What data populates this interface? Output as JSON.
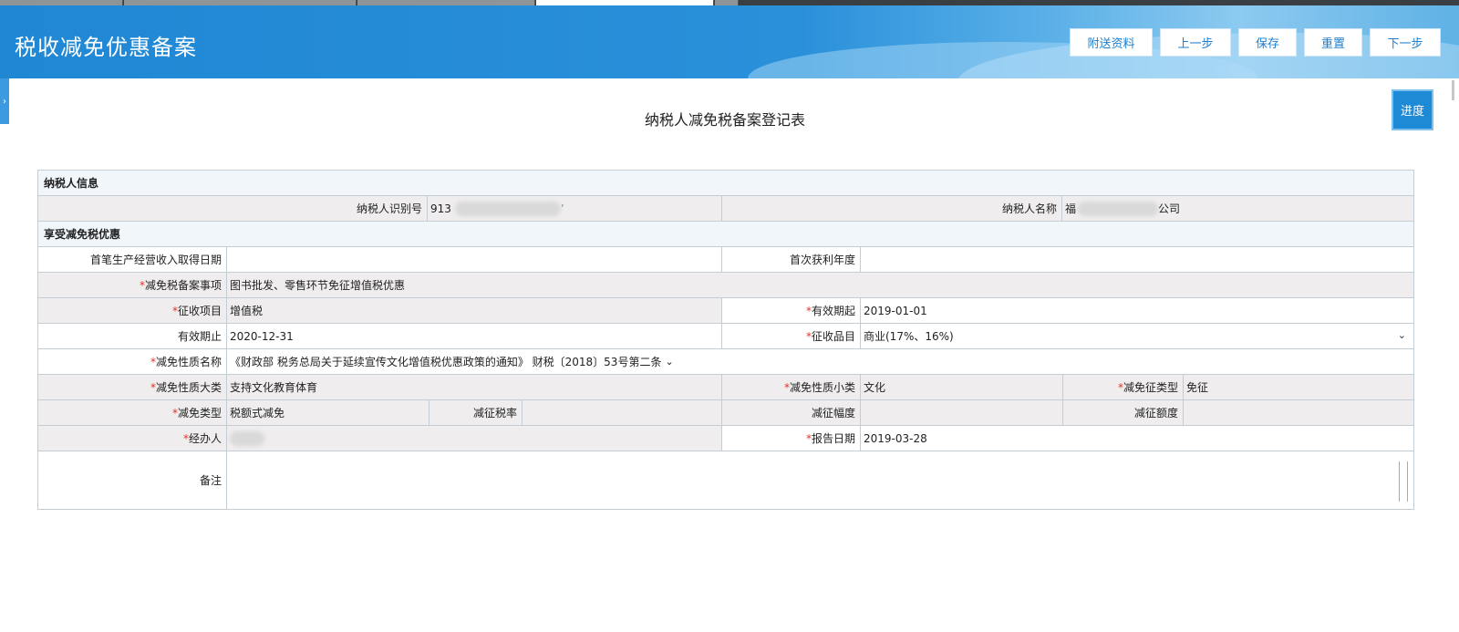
{
  "header": {
    "title": "税收减免优惠备案",
    "buttons": [
      "附送资料",
      "上一步",
      "保存",
      "重置",
      "下一步"
    ]
  },
  "progress_label": "进度",
  "form_title": "纳税人减免税备案登记表",
  "sections": {
    "taxpayer_info": "纳税人信息",
    "benefit": "享受减免税优惠"
  },
  "taxpayer": {
    "id_label": "纳税人识别号",
    "id_value_prefix": "913",
    "id_value_suffix": "’",
    "name_label": "纳税人名称",
    "name_value_prefix": "福",
    "name_value_suffix": "公司"
  },
  "fields": {
    "first_income_date_label": "首笔生产经营收入取得日期",
    "first_income_date_value": "",
    "first_profit_year_label": "首次获利年度",
    "first_profit_year_value": "",
    "filing_item_label": "减免税备案事项",
    "filing_item_value": "图书批发、零售环节免征增值税优惠",
    "levy_item_label": "征收项目",
    "levy_item_value": "增值税",
    "valid_from_label": "有效期起",
    "valid_from_value": "2019-01-01",
    "valid_to_label": "有效期止",
    "valid_to_value": "2020-12-31",
    "levy_category_label": "征收品目",
    "levy_category_value": "商业(17%、16%)",
    "nature_name_label": "减免性质名称",
    "nature_name_value": "《财政部 税务总局关于延续宣传文化增值税优惠政策的通知》 财税〔2018〕53号第二条",
    "nature_major_label": "减免性质大类",
    "nature_major_value": "支持文化教育体育",
    "nature_minor_label": "减免性质小类",
    "nature_minor_value": "文化",
    "exemption_type_label": "减免征类型",
    "exemption_type_value": "免征",
    "reduction_type_label": "减免类型",
    "reduction_type_value": "税额式减免",
    "reduction_rate_label": "减征税率",
    "reduction_rate_value": "",
    "reduction_range_label": "减征幅度",
    "reduction_range_value": "",
    "reduction_amount_label": "减征额度",
    "reduction_amount_value": "",
    "handler_label": "经办人",
    "report_date_label": "报告日期",
    "report_date_value": "2019-03-28",
    "remark_label": "备注",
    "remark_value": ""
  },
  "required_mark": "*",
  "colors": {
    "header_blue": "#1f87d4",
    "required_red": "#e2342a",
    "readonly_gray": "#efeded"
  }
}
